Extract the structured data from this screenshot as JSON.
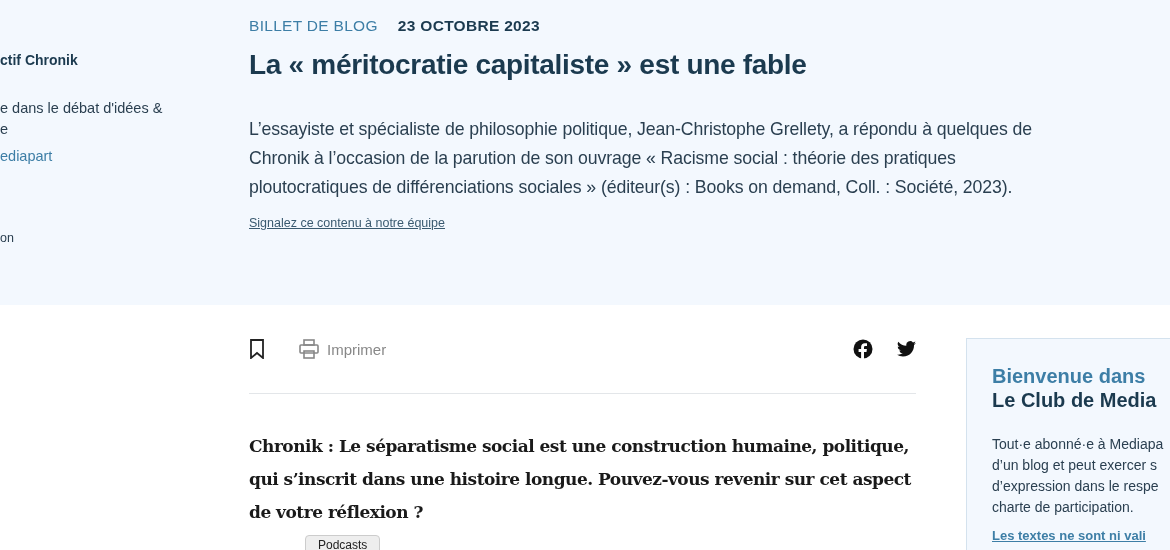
{
  "author_sidebar": {
    "name": "ctif Chronik",
    "bio_lines": [
      "e dans le débat d'idées &",
      "e"
    ],
    "link": "ediapart",
    "note": "on"
  },
  "header": {
    "category": "BILLET DE BLOG",
    "date": "23 OCTOBRE 2023",
    "title": "La « méritocratie capitaliste » est une fable",
    "intro": "L’essayiste et spécialiste de philosophie politique, Jean-Christophe Grellety, a répondu à quelques de Chronik à l’occasion de la parution de son ouvrage « Racisme social : théorie des pratiques ploutocratiques de différenciations sociales » (éditeur(s) : Books on demand, Coll. : Société, 2023).",
    "report_link": "Signalez ce contenu à notre équipe"
  },
  "toolbar": {
    "print_label": "Imprimer"
  },
  "article": {
    "question": "Chronik : Le séparatisme social est une construction humaine, politique, qui s’inscrit dans une histoire longue. Pouvez-vous revenir sur cet aspect de votre réflexion ?"
  },
  "tooltip": "Podcasts",
  "club_card": {
    "title_lines": [
      "Bienvenue dans",
      "Le Club de Media"
    ],
    "body_lines": [
      "Tout·e abonné·e à Mediapa",
      "d’un blog et peut exercer s",
      "d’expression dans le respe",
      "charte de participation."
    ],
    "notice": "Les textes ne sont ni vali"
  }
}
